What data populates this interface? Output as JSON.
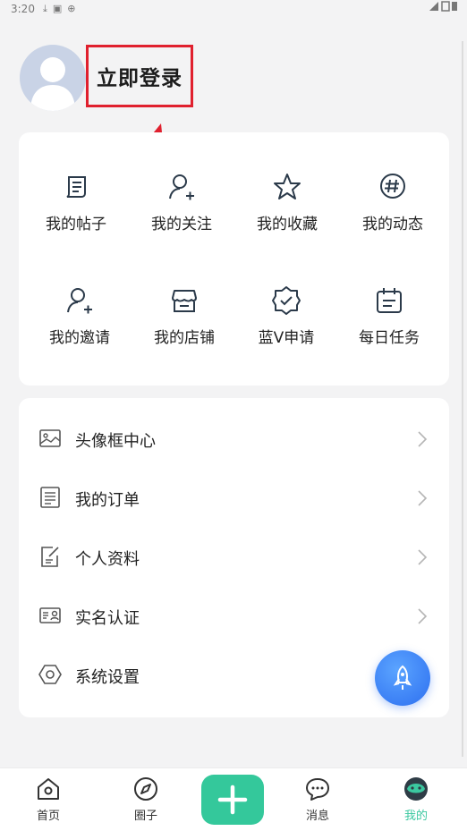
{
  "status_bar": {
    "time": "3:20"
  },
  "profile": {
    "login_label": "立即登录"
  },
  "quick_grid": {
    "items": [
      {
        "label": "我的帖子",
        "icon": "post-icon"
      },
      {
        "label": "我的关注",
        "icon": "follow-user-icon"
      },
      {
        "label": "我的收藏",
        "icon": "star-icon"
      },
      {
        "label": "我的动态",
        "icon": "hashtag-icon"
      },
      {
        "label": "我的邀请",
        "icon": "invite-user-icon"
      },
      {
        "label": "我的店铺",
        "icon": "shop-icon"
      },
      {
        "label": "蓝V申请",
        "icon": "verified-badge-icon"
      },
      {
        "label": "每日任务",
        "icon": "calendar-task-icon"
      }
    ]
  },
  "menu": {
    "items": [
      {
        "label": "头像框中心",
        "icon": "image-frame-icon",
        "chevron": true
      },
      {
        "label": "我的订单",
        "icon": "order-list-icon",
        "chevron": true
      },
      {
        "label": "个人资料",
        "icon": "edit-profile-icon",
        "chevron": true
      },
      {
        "label": "实名认证",
        "icon": "id-card-icon",
        "chevron": true
      },
      {
        "label": "系统设置",
        "icon": "settings-icon",
        "chevron": false
      }
    ]
  },
  "tabbar": {
    "tabs": [
      {
        "label": "首页",
        "icon": "home-icon"
      },
      {
        "label": "圈子",
        "icon": "compass-icon"
      },
      {
        "label": "",
        "icon": "plus-icon"
      },
      {
        "label": "消息",
        "icon": "message-icon"
      },
      {
        "label": "我的",
        "icon": "profile-face-icon"
      }
    ],
    "active": "我的"
  },
  "colors": {
    "accent_green": "#34c89b",
    "active_tab": "#3bc8a0",
    "annotation_red": "#e0202e",
    "fab_blue": "#2d6ff0"
  }
}
